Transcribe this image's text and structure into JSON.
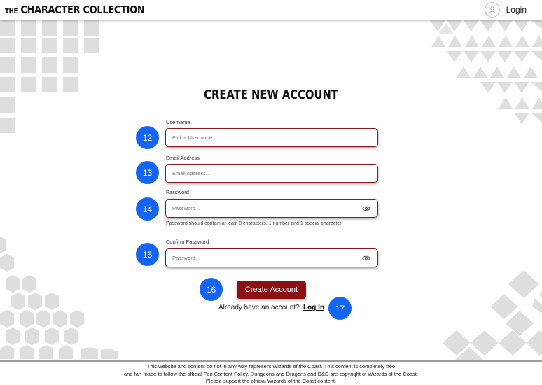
{
  "header": {
    "brand_prefix": "THE",
    "brand_main": "CHARACTER COLLECTION",
    "login_label": "Login"
  },
  "form": {
    "title": "CREATE NEW ACCOUNT",
    "username": {
      "label": "Username",
      "placeholder": "Pick a Username..."
    },
    "email": {
      "label": "Email Address",
      "placeholder": "Email Address..."
    },
    "password": {
      "label": "Password",
      "placeholder": "Password...",
      "hint": "Password should contain at least 8 characters, 1 number and 1 special character"
    },
    "confirm": {
      "label": "Confirm Password",
      "placeholder": "Password..."
    },
    "submit_label": "Create Account",
    "already_text": "Already have an account?",
    "login_link": "Log In"
  },
  "badges": [
    "12",
    "13",
    "14",
    "15",
    "16",
    "17"
  ],
  "footer": {
    "line1": "This website and content do not in any way represent Wizards of the Coast. This content is completely free",
    "line2_pre": "and fan-made to follow the official ",
    "line2_link": "Fan Content Policy",
    "line2_post": ". Dungeons and Dragons and D&D are copyright of Wizards of the Coast.",
    "line3": "Please support the official Wizards of the Coast content."
  },
  "colors": {
    "accent": "#8a1214",
    "badge": "#1465f3",
    "decoration": "#d9d9d9"
  },
  "icons": {
    "user": "user-icon",
    "eye": "eye-icon"
  }
}
